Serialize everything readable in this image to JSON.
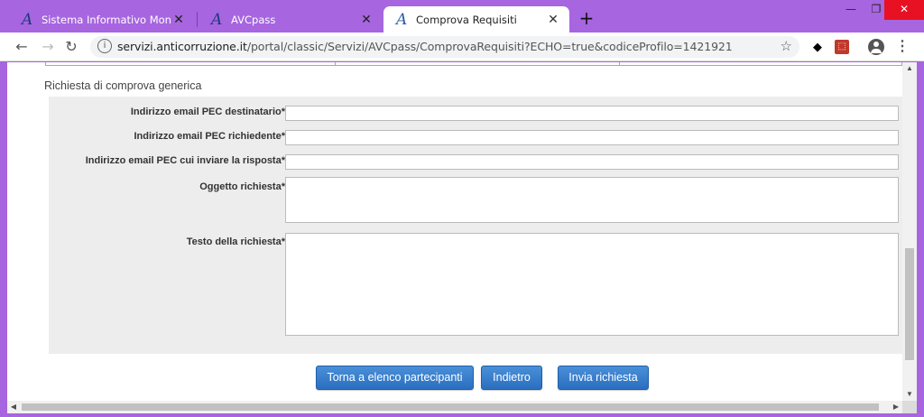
{
  "browser": {
    "tabs": [
      {
        "title": "Sistema Informativo Monitoragg",
        "logo": "A",
        "close": "✕"
      },
      {
        "title": "AVCpass",
        "logo": "A",
        "close": "✕"
      },
      {
        "title": "Comprova Requisiti",
        "logo": "A",
        "close": "✕"
      }
    ],
    "new_tab": "+",
    "window_controls": {
      "minimize": "—",
      "maximize": "❐",
      "close": "✕"
    },
    "nav": {
      "back": "←",
      "forward": "→",
      "reload": "↻"
    },
    "url_host": "servizi.anticorruzione.it",
    "url_path": "/portal/classic/Servizi/AVCpass/ComprovaRequisiti?ECHO=true&codiceProfilo=1421921",
    "star": "☆",
    "menu": "⋮"
  },
  "form": {
    "section_title": "Richiesta di comprova generica",
    "fields": [
      {
        "label": "Indirizzo email PEC destinatario*",
        "value": ""
      },
      {
        "label": "Indirizzo email PEC richiedente*",
        "value": ""
      },
      {
        "label": "Indirizzo email PEC cui inviare la risposta*",
        "value": ""
      },
      {
        "label": "Oggetto richiesta*",
        "value": ""
      },
      {
        "label": "Testo della richiesta*",
        "value": ""
      }
    ]
  },
  "actions": {
    "back_to_list": "Torna a elenco partecipanti",
    "back": "Indietro",
    "send": "Invia richiesta"
  },
  "scrollbar": {
    "up": "▲",
    "down": "▼",
    "left": "◀",
    "right": "▶"
  },
  "colors": {
    "window_frame": "#a765e0",
    "button": "#2a6fc0",
    "panel": "#ededed"
  }
}
